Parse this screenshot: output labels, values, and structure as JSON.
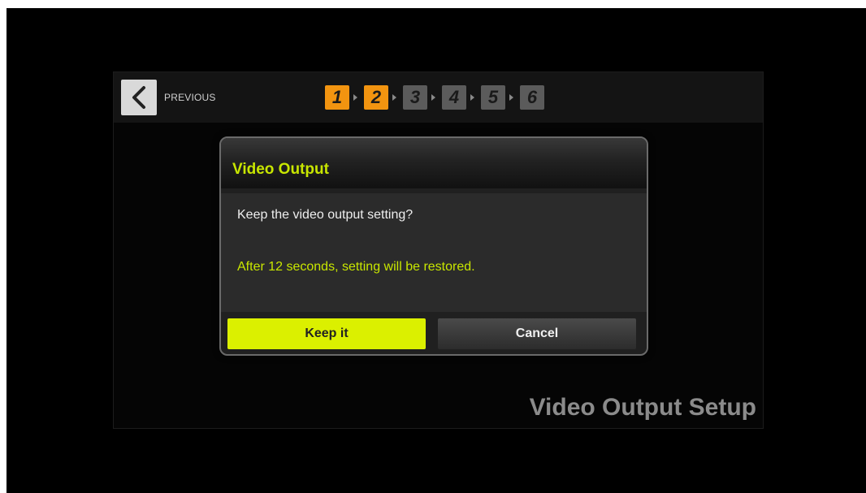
{
  "header": {
    "previous_label": "PREVIOUS",
    "steps": [
      {
        "label": "1",
        "state": "completed"
      },
      {
        "label": "2",
        "state": "current"
      },
      {
        "label": "3",
        "state": "pending"
      },
      {
        "label": "4",
        "state": "pending"
      },
      {
        "label": "5",
        "state": "pending"
      },
      {
        "label": "6",
        "state": "pending"
      }
    ]
  },
  "page": {
    "title": "Video Output Setup"
  },
  "dialog": {
    "title": "Video Output",
    "message": "Keep the video output setting?",
    "countdown_text": "After 12 seconds, setting will be restored.",
    "keep_label": "Keep it",
    "cancel_label": "Cancel"
  },
  "colors": {
    "accent": "#c8e600",
    "step_active": "#f29410",
    "step_inactive": "#5b5b5b"
  },
  "icons": {
    "back": "chevron-left-icon"
  }
}
